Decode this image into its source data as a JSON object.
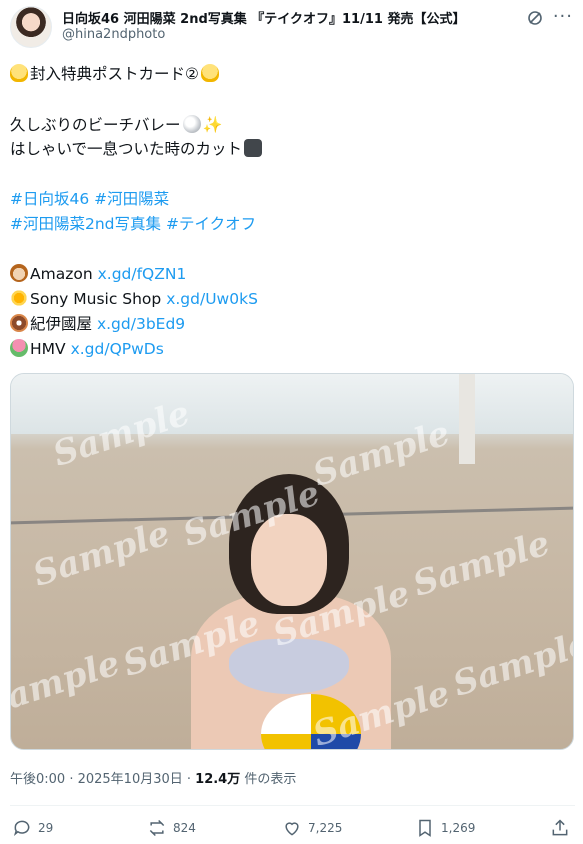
{
  "header": {
    "name": "日向坂46 河田陽菜 2nd写真集 『テイクオフ』11/11 発売【公式】",
    "handle": "@hina2ndphoto"
  },
  "tweet": {
    "line1": "封入特典ポストカード②",
    "line2": "久しぶりのビーチバレー",
    "line3": "はしゃいで一息ついた時のカット",
    "hashtag1": "#日向坂46",
    "hashtag2": "#河田陽菜",
    "hashtag3": "#河田陽菜2nd写真集",
    "hashtag4": "#テイクオフ",
    "shops": [
      {
        "label": "Amazon",
        "link": "x.gd/fQZN1"
      },
      {
        "label": "Sony Music Shop",
        "link": "x.gd/Uw0kS"
      },
      {
        "label": "紀伊國屋",
        "link": "x.gd/3bEd9"
      },
      {
        "label": "HMV",
        "link": "x.gd/QPwDs"
      }
    ]
  },
  "photo": {
    "watermark": "Sample"
  },
  "meta": {
    "time": "午後0:00 · 2025年10月30日 · ",
    "views": "12.4万",
    "views_suffix": " 件の表示"
  },
  "actions": {
    "replies": "29",
    "reposts": "824",
    "likes": "7,225",
    "bookmarks": "1,269"
  },
  "icons": [
    "grok-icon",
    "more-icon",
    "reply-icon",
    "repost-icon",
    "like-icon",
    "bookmark-icon",
    "share-icon"
  ]
}
